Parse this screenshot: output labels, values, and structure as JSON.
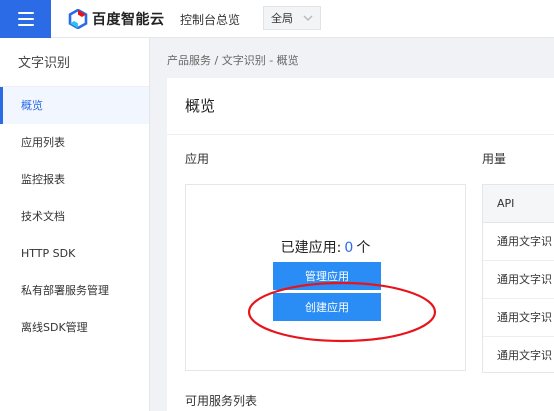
{
  "header": {
    "brand": "百度智能云",
    "console_link": "控制台总览",
    "region": "全局"
  },
  "sidebar": {
    "title": "文字识别",
    "items": [
      {
        "label": "概览",
        "active": true
      },
      {
        "label": "应用列表"
      },
      {
        "label": "监控报表"
      },
      {
        "label": "技术文档"
      },
      {
        "label": "HTTP SDK"
      },
      {
        "label": "私有部署服务管理"
      },
      {
        "label": "离线SDK管理"
      }
    ]
  },
  "breadcrumb": {
    "root": "产品服务",
    "separator": " / ",
    "current": "文字识别 - 概览"
  },
  "main": {
    "title": "概览",
    "app_section": {
      "title": "应用",
      "count_label": "已建应用:",
      "count_value": "0",
      "count_unit": "个",
      "manage_button": "管理应用",
      "create_button": "创建应用"
    },
    "usage_section": {
      "title": "用量",
      "header": "API",
      "rows": [
        "通用文字识",
        "通用文字识",
        "通用文字识",
        "通用文字识"
      ]
    },
    "services_title": "可用服务列表"
  },
  "colors": {
    "primary": "#2b6be6",
    "button": "#2a8cf5",
    "annotation": "#e8141b"
  }
}
